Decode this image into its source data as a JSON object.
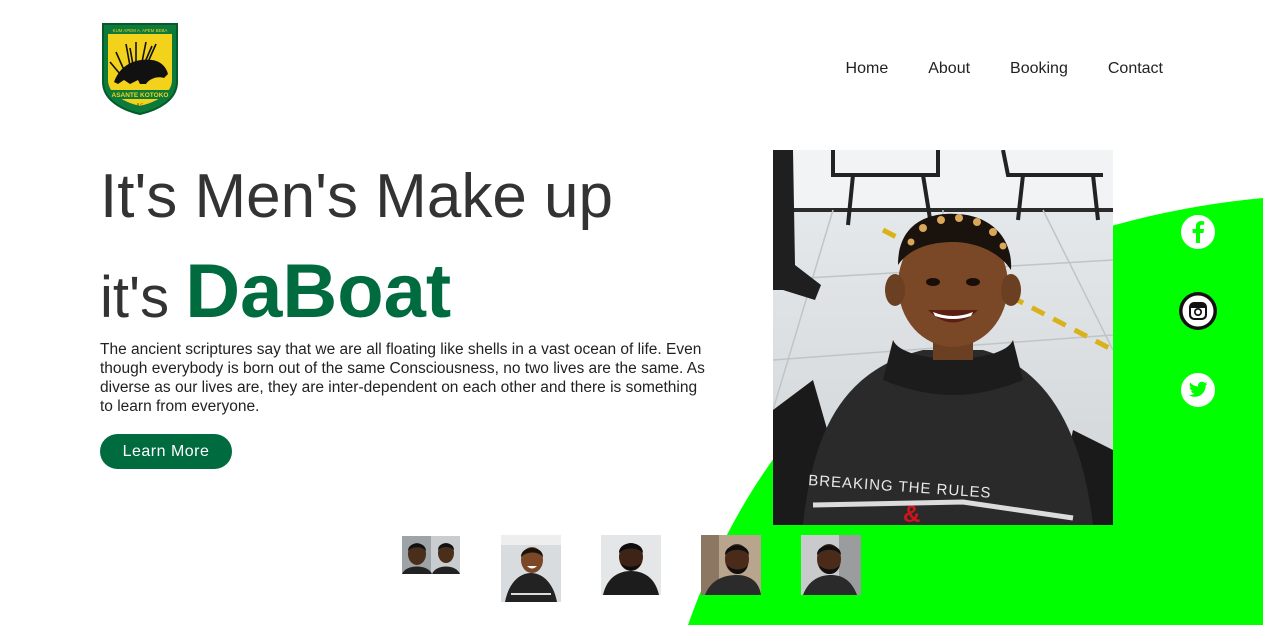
{
  "brand": {
    "logo_top_text": "KUM APEM A, APEM BEBA",
    "logo_bottom_text": "ASANTE KOTOKO",
    "logo_sc": "S.C",
    "colors": {
      "green": "#006b3f",
      "gold": "#f3d21c",
      "swoosh": "#00ff00"
    }
  },
  "nav": {
    "items": [
      {
        "label": "Home"
      },
      {
        "label": "About"
      },
      {
        "label": "Booking"
      },
      {
        "label": "Contact"
      }
    ]
  },
  "hero": {
    "line1": "It's Men's Make up",
    "line2_prefix": "it's ",
    "line2_brand": "DaBoat",
    "description": "The ancient scriptures say that we are all floating like shells in a vast ocean of life. Even though everybody is born out of the same Consciousness, no two lives are the same. As diverse as our lives are, they are inter-dependent on each other and there is something to learn from everyone.",
    "cta_label": "Learn More"
  },
  "main_image": {
    "apron_text": "BREAKING THE RULES"
  },
  "socials": [
    {
      "icon": "facebook-icon"
    },
    {
      "icon": "instagram-icon"
    },
    {
      "icon": "twitter-icon"
    }
  ],
  "thumbnails": [
    {
      "name": "thumbnail-1"
    },
    {
      "name": "thumbnail-2"
    },
    {
      "name": "thumbnail-3"
    },
    {
      "name": "thumbnail-4"
    },
    {
      "name": "thumbnail-5"
    }
  ]
}
